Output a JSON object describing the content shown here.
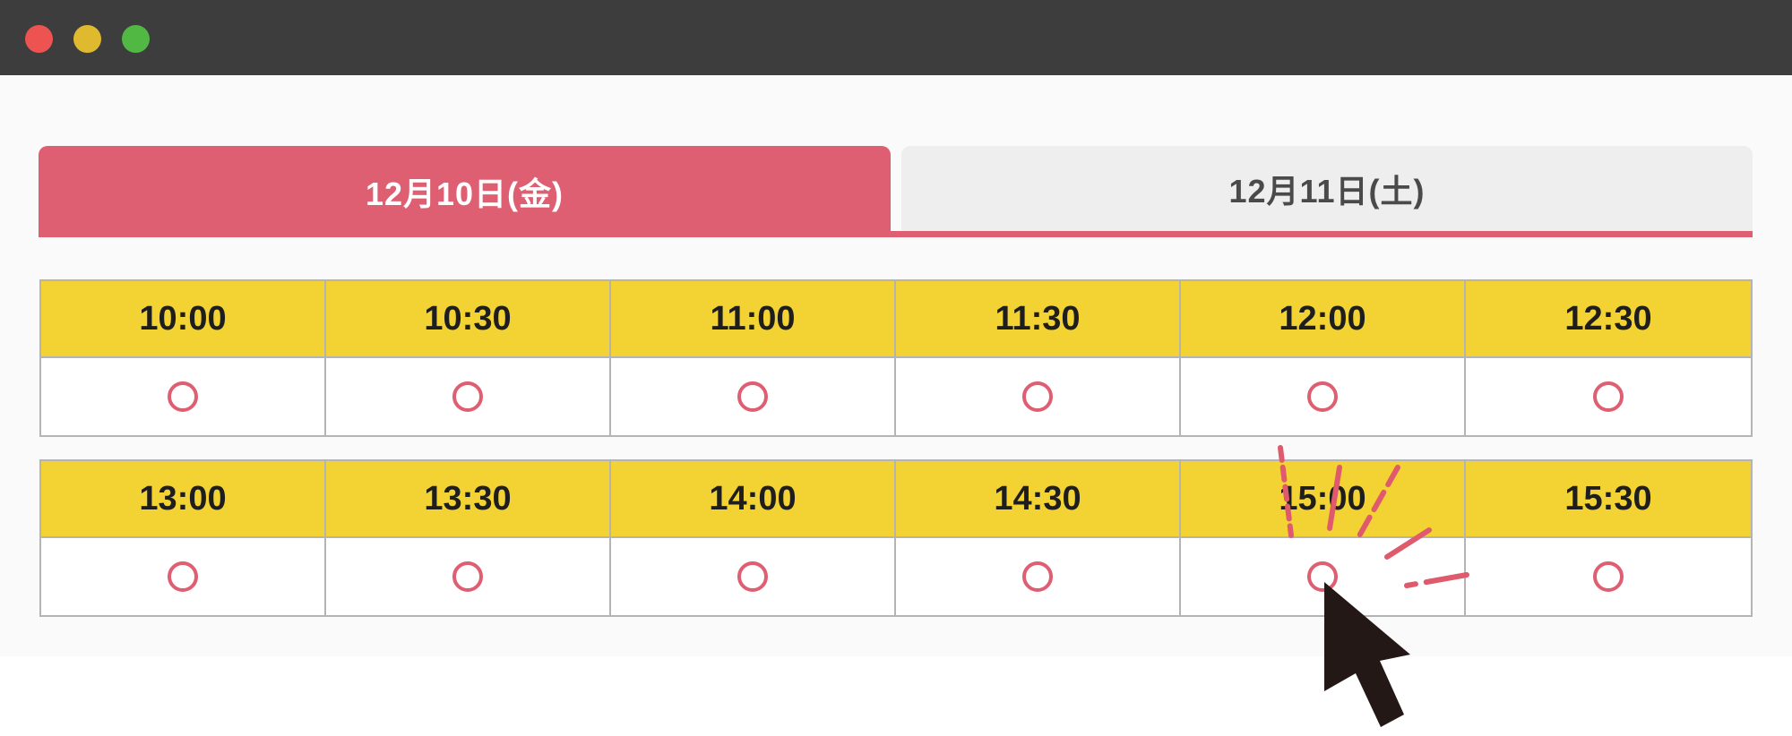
{
  "window": {
    "controls": [
      "close",
      "minimize",
      "maximize"
    ]
  },
  "tabs": [
    {
      "label": "12月10日(金)",
      "active": true
    },
    {
      "label": "12月11日(土)",
      "active": false
    }
  ],
  "schedule": {
    "rows": [
      {
        "times": [
          "10:00",
          "10:30",
          "11:00",
          "11:30",
          "12:00",
          "12:30"
        ],
        "availability": [
          "○",
          "○",
          "○",
          "○",
          "○",
          "○"
        ]
      },
      {
        "times": [
          "13:00",
          "13:30",
          "14:00",
          "14:30",
          "15:00",
          "15:30"
        ],
        "availability": [
          "○",
          "○",
          "○",
          "○",
          "○",
          "○"
        ]
      }
    ]
  },
  "colors": {
    "accent": "#df5f72",
    "header_yellow": "#f3d234",
    "titlebar": "#3d3d3d"
  },
  "icons": {
    "available": "circle-icon",
    "cursor": "mouse-pointer-icon",
    "click_effect": "click-burst-icon"
  }
}
